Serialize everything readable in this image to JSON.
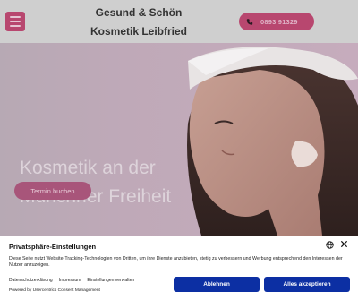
{
  "header": {
    "brand_line1": "Gesund & Schön",
    "brand_line2": "Kosmetik Leibfried",
    "phone": "0893 91329"
  },
  "hero": {
    "title_line1": "Kosmetik an der",
    "title_line2": "Münchner Freiheit",
    "cta": "Termin buchen"
  },
  "consent": {
    "title": "Privatsphäre-Einstellungen",
    "text": "Diese Seite nutzt Website-Tracking-Technologien von Dritten, um ihre Dienste anzubieten, stetig zu verbessern und Werbung entsprechend den Interessen der Nutzer anzuzeigen.",
    "links": [
      "Datenschutzerklärung",
      "Impressum",
      "Einstellungen verwalten"
    ],
    "powered_by": "Powered by Usercentrics Consent Management",
    "deny": "Ablehnen",
    "accept": "Alles akzeptieren"
  },
  "colors": {
    "brand": "#b8476f",
    "consent_button": "#0c2fa3"
  }
}
